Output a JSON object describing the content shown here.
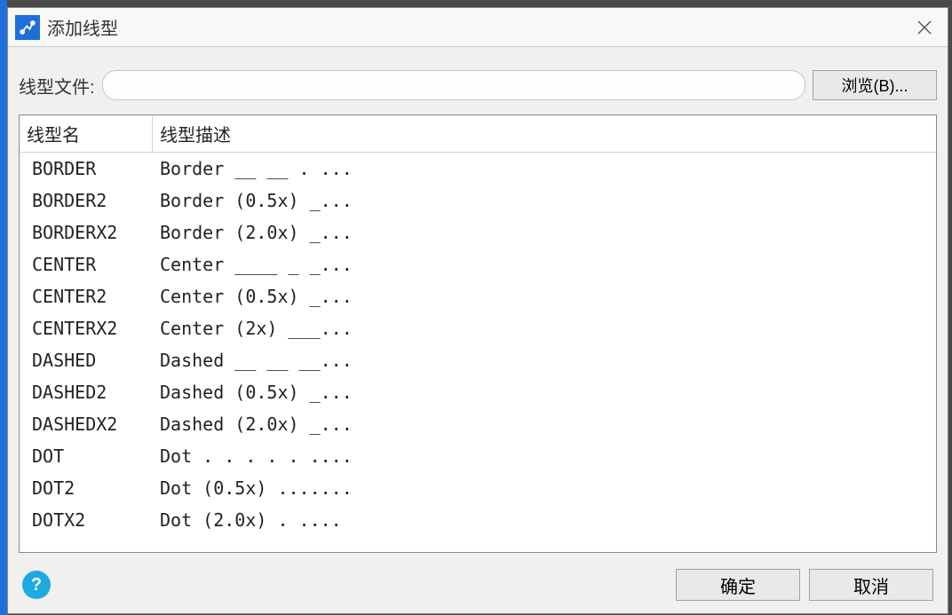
{
  "window": {
    "title": "添加线型"
  },
  "fileRow": {
    "label": "线型文件:",
    "value": "",
    "browse": "浏览(B)..."
  },
  "list": {
    "header": {
      "name": "线型名",
      "desc": "线型描述"
    },
    "rows": [
      {
        "name": "BORDER",
        "desc": "Border __ __ . ..."
      },
      {
        "name": "BORDER2",
        "desc": "Border (0.5x) _..."
      },
      {
        "name": "BORDERX2",
        "desc": "Border (2.0x) _..."
      },
      {
        "name": "CENTER",
        "desc": "Center ____ _ _..."
      },
      {
        "name": "CENTER2",
        "desc": "Center (0.5x) _..."
      },
      {
        "name": "CENTERX2",
        "desc": "Center (2x) ___..."
      },
      {
        "name": "DASHED",
        "desc": "Dashed __ __ __..."
      },
      {
        "name": "DASHED2",
        "desc": "Dashed (0.5x) _..."
      },
      {
        "name": "DASHEDX2",
        "desc": "Dashed (2.0x) _..."
      },
      {
        "name": "DOT",
        "desc": "Dot . . . . . ...."
      },
      {
        "name": "DOT2",
        "desc": "Dot (0.5x) ......."
      },
      {
        "name": "DOTX2",
        "desc": "Dot (2.0x) .  ...."
      }
    ]
  },
  "footer": {
    "ok": "确定",
    "cancel": "取消"
  }
}
